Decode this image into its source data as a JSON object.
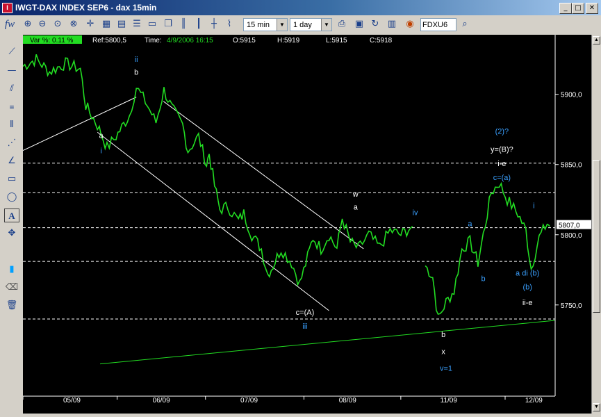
{
  "window": {
    "title": "IWGT-DAX INDEX SEP6 - dax 15min",
    "app_icon_text": "I",
    "controls": [
      "_",
      "□",
      "✕"
    ]
  },
  "toolbar": {
    "fw_label": "fw",
    "interval_value": "15 min",
    "span_value": "1 day",
    "symbol_value": "FDXU6"
  },
  "info_bar": {
    "var": "Var %: 0.11 %",
    "ref": "Ref:5800,5",
    "time_label": "Time:",
    "time_value": "4/9/2006 16:15",
    "open": "O:5915",
    "high": "H:5919",
    "low": "L:5915",
    "close": "C:5918"
  },
  "chart_data": {
    "type": "line",
    "yticks": [
      5750,
      5800,
      5850,
      5900
    ],
    "ytick_labels": [
      "5750,0",
      "5800,0",
      "5850,0",
      "5900,0"
    ],
    "xtick_labels": [
      "05/09",
      "06/09",
      "07/09",
      "08/09",
      "11/09",
      "12/09"
    ],
    "current_price_label": "5807,0",
    "current_price": 5807,
    "dashed_levels": [
      5851,
      5830,
      5805,
      5781,
      5740
    ],
    "series_color": "#22dd22",
    "price_path": [
      [
        0,
        5920
      ],
      [
        0.025,
        5925
      ],
      [
        0.05,
        5916
      ],
      [
        0.08,
        5922
      ],
      [
        0.108,
        5918
      ],
      [
        0.118,
        5892
      ],
      [
        0.14,
        5878
      ],
      [
        0.158,
        5862
      ],
      [
        0.175,
        5870
      ],
      [
        0.2,
        5885
      ],
      [
        0.213,
        5905
      ],
      [
        0.23,
        5895
      ],
      [
        0.25,
        5880
      ],
      [
        0.265,
        5903
      ],
      [
        0.28,
        5890
      ],
      [
        0.3,
        5878
      ],
      [
        0.31,
        5860
      ],
      [
        0.33,
        5870
      ],
      [
        0.345,
        5850
      ],
      [
        0.35,
        5858
      ],
      [
        0.36,
        5835
      ],
      [
        0.37,
        5818
      ],
      [
        0.385,
        5820
      ],
      [
        0.405,
        5810
      ],
      [
        0.415,
        5815
      ],
      [
        0.43,
        5800
      ],
      [
        0.448,
        5790
      ],
      [
        0.46,
        5772
      ],
      [
        0.47,
        5778
      ],
      [
        0.485,
        5790
      ],
      [
        0.505,
        5780
      ],
      [
        0.52,
        5765
      ],
      [
        0.535,
        5784
      ],
      [
        0.545,
        5798
      ],
      [
        0.56,
        5790
      ],
      [
        0.575,
        5800
      ],
      [
        0.59,
        5790
      ],
      [
        0.6,
        5812
      ],
      [
        0.615,
        5795
      ],
      [
        0.63,
        5790
      ],
      [
        0.65,
        5800
      ],
      [
        0.67,
        5791
      ],
      [
        0.69,
        5803
      ],
      [
        0.71,
        5800
      ],
      [
        0.732,
        5806
      ]
    ],
    "price_path_2": [
      [
        0.756,
        5778
      ],
      [
        0.77,
        5770
      ],
      [
        0.78,
        5740
      ],
      [
        0.795,
        5752
      ],
      [
        0.81,
        5760
      ],
      [
        0.825,
        5790
      ],
      [
        0.84,
        5795
      ],
      [
        0.855,
        5780
      ],
      [
        0.865,
        5800
      ],
      [
        0.88,
        5830
      ],
      [
        0.895,
        5837
      ],
      [
        0.91,
        5825
      ],
      [
        0.93,
        5815
      ],
      [
        0.945,
        5803
      ],
      [
        0.955,
        5776
      ],
      [
        0.97,
        5798
      ],
      [
        0.985,
        5808
      ],
      [
        0.99,
        5806
      ]
    ],
    "trendlines": [
      {
        "name": "upper-channel-line",
        "color": "#ffffff",
        "from": [
          0.264,
          5895
        ],
        "to": [
          0.64,
          5790
        ]
      },
      {
        "name": "lower-channel-line",
        "color": "#ffffff",
        "from": [
          0.14,
          5873
        ],
        "to": [
          0.575,
          5746
        ]
      },
      {
        "name": "left-rising-line",
        "color": "#ffffff",
        "from": [
          0,
          5860
        ],
        "to": [
          0.213,
          5898
        ]
      },
      {
        "name": "green-support-line",
        "color": "#22dd22",
        "from": [
          0.145,
          5708
        ],
        "to": [
          1.0,
          5739
        ]
      }
    ],
    "annotations": [
      {
        "text": "ii",
        "color": "#3aa0ff",
        "x": 0.213,
        "y": 5923
      },
      {
        "text": "b",
        "color": "#ffffff",
        "x": 0.213,
        "y": 5914
      },
      {
        "text": "a",
        "color": "#ffffff",
        "x": 0.147,
        "y": 5869
      },
      {
        "text": "i",
        "color": "#3aa0ff",
        "x": 0.147,
        "y": 5858
      },
      {
        "text": "w",
        "color": "#ffffff",
        "x": 0.625,
        "y": 5827
      },
      {
        "text": "a",
        "color": "#ffffff",
        "x": 0.625,
        "y": 5818
      },
      {
        "text": "iv",
        "color": "#3aa0ff",
        "x": 0.737,
        "y": 5814
      },
      {
        "text": "c=(A)",
        "color": "#ffffff",
        "x": 0.53,
        "y": 5743
      },
      {
        "text": "iii",
        "color": "#3aa0ff",
        "x": 0.53,
        "y": 5733
      },
      {
        "text": "b",
        "color": "#ffffff",
        "x": 0.79,
        "y": 5727
      },
      {
        "text": "x",
        "color": "#ffffff",
        "x": 0.79,
        "y": 5715
      },
      {
        "text": "v=1",
        "color": "#3aa0ff",
        "x": 0.795,
        "y": 5703
      },
      {
        "text": "a",
        "color": "#3aa0ff",
        "x": 0.84,
        "y": 5806
      },
      {
        "text": "b",
        "color": "#3aa0ff",
        "x": 0.865,
        "y": 5767
      },
      {
        "text": "(2)?",
        "color": "#3aa0ff",
        "x": 0.9,
        "y": 5872
      },
      {
        "text": "y=(B)?",
        "color": "#ffffff",
        "x": 0.9,
        "y": 5859
      },
      {
        "text": "i-e",
        "color": "#ffffff",
        "x": 0.9,
        "y": 5849
      },
      {
        "text": "c=(a)",
        "color": "#3aa0ff",
        "x": 0.9,
        "y": 5839
      },
      {
        "text": "i",
        "color": "#3aa0ff",
        "x": 0.96,
        "y": 5819
      },
      {
        "text": "a di (b)",
        "color": "#3aa0ff",
        "x": 0.948,
        "y": 5771
      },
      {
        "text": "(b)",
        "color": "#3aa0ff",
        "x": 0.948,
        "y": 5761
      },
      {
        "text": "ii-e",
        "color": "#ffffff",
        "x": 0.948,
        "y": 5750
      }
    ]
  }
}
